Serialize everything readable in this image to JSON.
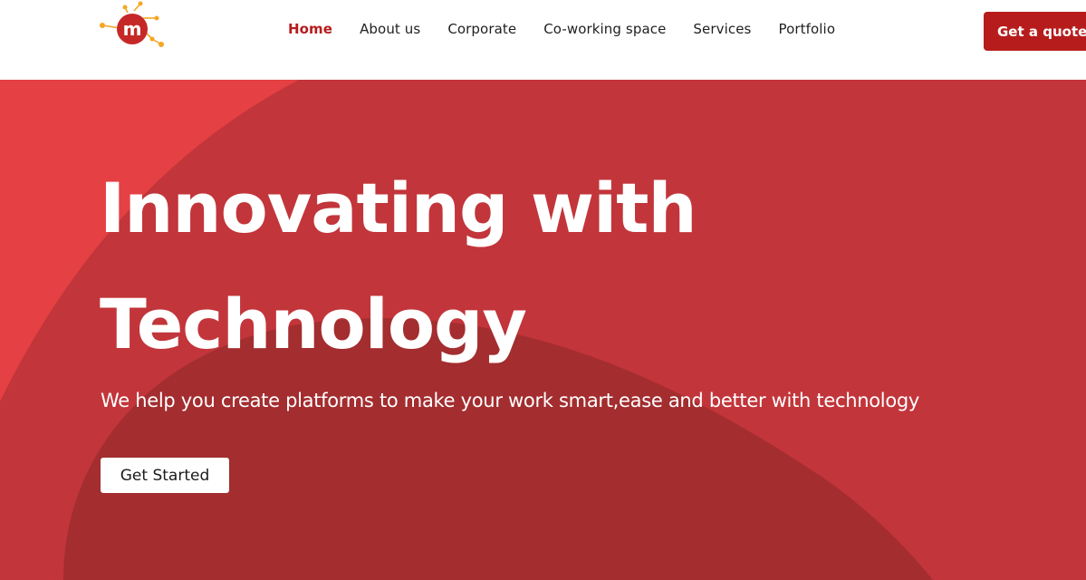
{
  "header": {
    "logo_letter": "m",
    "nav": [
      {
        "label": "Home",
        "active": true
      },
      {
        "label": "About us",
        "active": false
      },
      {
        "label": "Corporate",
        "active": false
      },
      {
        "label": "Co-working space",
        "active": false
      },
      {
        "label": "Services",
        "active": false
      },
      {
        "label": "Portfolio",
        "active": false
      }
    ],
    "cta_label": "Get a quote"
  },
  "hero": {
    "title_line1": "Innovating with",
    "title_line2": "Technology",
    "subtitle": "We help you create platforms to make your work smart,ease and better with technology",
    "button_label": "Get Started"
  },
  "colors": {
    "brand_red": "#b71c1c",
    "hero_bg": "#c2353a",
    "hero_light": "#e54043",
    "hero_dark": "#a32d2f",
    "logo_orange": "#f5a623"
  }
}
